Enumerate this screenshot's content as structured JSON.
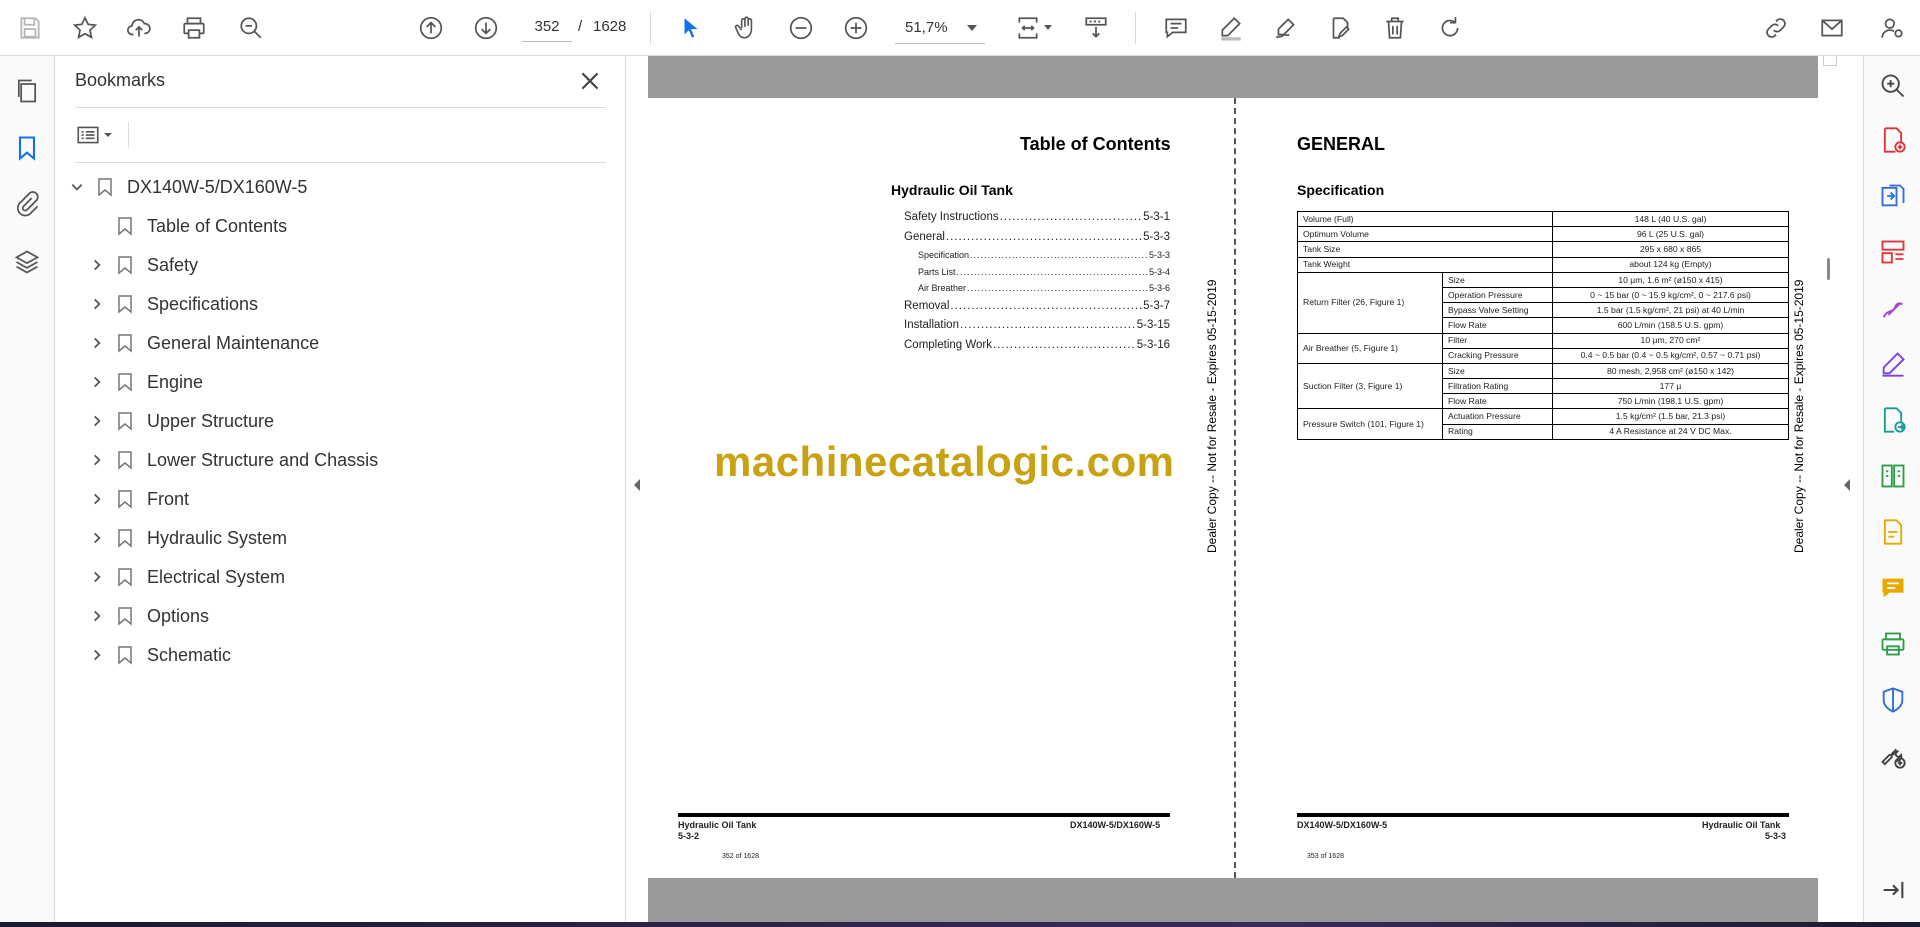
{
  "toolbar": {
    "current_page": "352",
    "separator": "/",
    "total_pages": "1628",
    "zoom": "51,7%"
  },
  "bookmarks_panel": {
    "title": "Bookmarks",
    "items": [
      {
        "label": "DX140W-5/DX160W-5",
        "expanded": true,
        "level": 0
      },
      {
        "label": "Table of Contents",
        "level": 1,
        "has_children": false
      },
      {
        "label": "Safety",
        "level": 1,
        "has_children": true
      },
      {
        "label": "Specifications",
        "level": 1,
        "has_children": true
      },
      {
        "label": "General Maintenance",
        "level": 1,
        "has_children": true
      },
      {
        "label": "Engine",
        "level": 1,
        "has_children": true
      },
      {
        "label": "Upper Structure",
        "level": 1,
        "has_children": true
      },
      {
        "label": "Lower Structure and Chassis",
        "level": 1,
        "has_children": true
      },
      {
        "label": "Front",
        "level": 1,
        "has_children": true
      },
      {
        "label": "Hydraulic System",
        "level": 1,
        "has_children": true
      },
      {
        "label": "Electrical System",
        "level": 1,
        "has_children": true
      },
      {
        "label": "Options",
        "level": 1,
        "has_children": true
      },
      {
        "label": "Schematic",
        "level": 1,
        "has_children": true
      }
    ]
  },
  "left_page": {
    "title": "Table of Contents",
    "section": "Hydraulic Oil Tank",
    "toc": [
      {
        "label": "Safety Instructions",
        "page": "5-3-1",
        "sub": false
      },
      {
        "label": "General",
        "page": "5-3-3",
        "sub": false
      },
      {
        "label": "Specification",
        "page": "5-3-3",
        "sub": true
      },
      {
        "label": "Parts List",
        "page": "5-3-4",
        "sub": true
      },
      {
        "label": "Air Breather",
        "page": "5-3-6",
        "sub": true
      },
      {
        "label": "Removal",
        "page": "5-3-7",
        "sub": false
      },
      {
        "label": "Installation",
        "page": "5-3-15",
        "sub": false
      },
      {
        "label": "Completing Work",
        "page": "5-3-16",
        "sub": false
      }
    ],
    "footer_left_title": "Hydraulic Oil Tank",
    "footer_left_page": "5-3-2",
    "footer_right": "DX140W-5/DX160W-5",
    "page_counter": "352 of 1628",
    "vertical_note": "Dealer Copy -- Not for Resale - Expires 05-15-2019"
  },
  "watermark": "machinecatalogic.com",
  "right_page": {
    "title": "GENERAL",
    "section": "Specification",
    "spec_rows": {
      "volume_full": {
        "label": "Volume (Full)",
        "value": "148 L (40 U.S. gal)"
      },
      "optimum_volume": {
        "label": "Optimum Volume",
        "value": "96 L (25 U.S. gal)"
      },
      "tank_size": {
        "label": "Tank Size",
        "value": "295 x 680 x 865"
      },
      "tank_weight": {
        "label": "Tank Weight",
        "value": "about 124 kg (Empty)"
      },
      "return_filter": {
        "label": "Return Filter (26, Figure 1)",
        "rows": [
          {
            "label": "Size",
            "value": "10 µm, 1.6 m² (ø150 x 415)"
          },
          {
            "label": "Operation Pressure",
            "value": "0 ~ 15 bar (0 ~ 15.9 kg/cm², 0 ~ 217.6 psi)"
          },
          {
            "label": "Bypass Valve Setting",
            "value": "1.5 bar (1.5 kg/cm², 21 psi) at 40 L/min"
          },
          {
            "label": "Flow Rate",
            "value": "600 L/min (158.5 U.S. gpm)"
          }
        ]
      },
      "air_breather": {
        "label": "Air Breather (5, Figure 1)",
        "rows": [
          {
            "label": "Filter",
            "value": "10 µm, 270 cm²"
          },
          {
            "label": "Cracking Pressure",
            "value": "0.4 ~ 0.5 bar (0.4 ~ 0.5 kg/cm², 0.57 ~ 0.71 psi)"
          }
        ]
      },
      "suction_filter": {
        "label": "Suction Filter (3, Figure 1)",
        "rows": [
          {
            "label": "Size",
            "value": "80 mesh, 2,958 cm² (ø150 x 142)"
          },
          {
            "label": "Filtration Rating",
            "value": "177 µ"
          },
          {
            "label": "Flow Rate",
            "value": "750 L/min (198.1 U.S. gpm)"
          }
        ]
      },
      "pressure_switch": {
        "label": "Pressure Switch (101, Figure 1)",
        "rows": [
          {
            "label": "Actuation Pressure",
            "value": "1.5 kg/cm² (1.5 bar, 21.3 psi)"
          },
          {
            "label": "Rating",
            "value": "4 A Resistance at 24 V DC Max."
          }
        ]
      }
    },
    "footer_left": "DX140W-5/DX160W-5",
    "footer_right_title": "Hydraulic Oil Tank",
    "footer_right_page": "5-3-3",
    "page_counter": "353 of 1628",
    "vertical_note": "Dealer Copy -- Not for Resale - Expires 05-15-2019"
  },
  "colors": {
    "accent_blue": "#1473e6",
    "watermark": "#c9a212",
    "rail_red": "#e0343a",
    "rail_purple": "#7b3fe4",
    "rail_green": "#2d9d4a",
    "rail_yellow": "#e8a800"
  }
}
